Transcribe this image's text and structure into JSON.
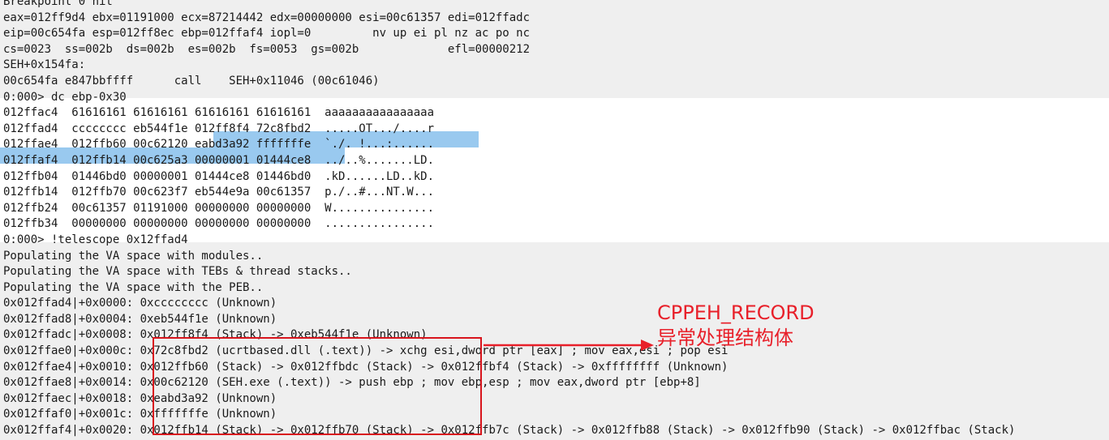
{
  "console": {
    "lines": [
      "Breakpoint 0 hit",
      "eax=012ff9d4 ebx=01191000 ecx=87214442 edx=00000000 esi=00c61357 edi=012ffadc",
      "eip=00c654fa esp=012ff8ec ebp=012ffaf4 iopl=0         nv up ei pl nz ac po nc",
      "cs=0023  ss=002b  ds=002b  es=002b  fs=0053  gs=002b             efl=00000212",
      "SEH+0x154fa:",
      "00c654fa e847bbffff      call    SEH+0x11046 (00c61046)",
      "0:000> dc ebp-0x30",
      "012ffac4  61616161 61616161 61616161 61616161  aaaaaaaaaaaaaaaa",
      "012ffad4  cccccccc eb544f1e 012ff8f4 72c8fbd2  .....OT.../....r",
      "012ffae4  012ffb60 00c62120 eabd3a92 fffffffe  `./. !...:......",
      "012ffaf4  012ffb14 00c625a3 00000001 01444ce8  ../..%.......LD.",
      "012ffb04  01446bd0 00000001 01444ce8 01446bd0  .kD......LD..kD.",
      "012ffb14  012ffb70 00c623f7 eb544e9a 00c61357  p./..#...NT.W...",
      "012ffb24  00c61357 01191000 00000000 00000000  W...............",
      "012ffb34  00000000 00000000 00000000 00000000  ................",
      "0:000> !telescope 0x12ffad4",
      "Populating the VA space with modules..",
      "Populating the VA space with TEBs & thread stacks..",
      "Populating the VA space with the PEB..",
      "0x012ffad4|+0x0000: 0xcccccccc (Unknown)",
      "0x012ffad8|+0x0004: 0xeb544f1e (Unknown)",
      "0x012ffadc|+0x0008: 0x012ff8f4 (Stack) -> 0xeb544f1e (Unknown)",
      "0x012ffae0|+0x000c: 0x72c8fbd2 (ucrtbased.dll (.text)) -> xchg esi,dword ptr [eax] ; mov eax,esi ; pop esi",
      "0x012ffae4|+0x0010: 0x012ffb60 (Stack) -> 0x012ffbdc (Stack) -> 0x012ffbf4 (Stack) -> 0xffffffff (Unknown)",
      "0x012ffae8|+0x0014: 0x00c62120 (SEH.exe (.text)) -> push ebp ; mov ebp,esp ; mov eax,dword ptr [ebp+8]",
      "0x012ffaec|+0x0018: 0xeabd3a92 (Unknown)",
      "0x012ffaf0|+0x001c: 0xfffffffe (Unknown)",
      "0x012ffaf4|+0x0020: 0x012ffb14 (Stack) -> 0x012ffb70 (Stack) -> 0x012ffb7c (Stack) -> 0x012ffb88 (Stack) -> 0x012ffb90 (Stack) -> 0x012ffbac (Stack)"
    ]
  },
  "annotation": {
    "line1": "CPPEH_RECORD",
    "line2": "异常处理结构体",
    "color": "#e8202a"
  },
  "colors": {
    "background": "#efefef",
    "output_block": "#ffffff",
    "selection": "#99c9ef",
    "box": "#d8141c"
  }
}
